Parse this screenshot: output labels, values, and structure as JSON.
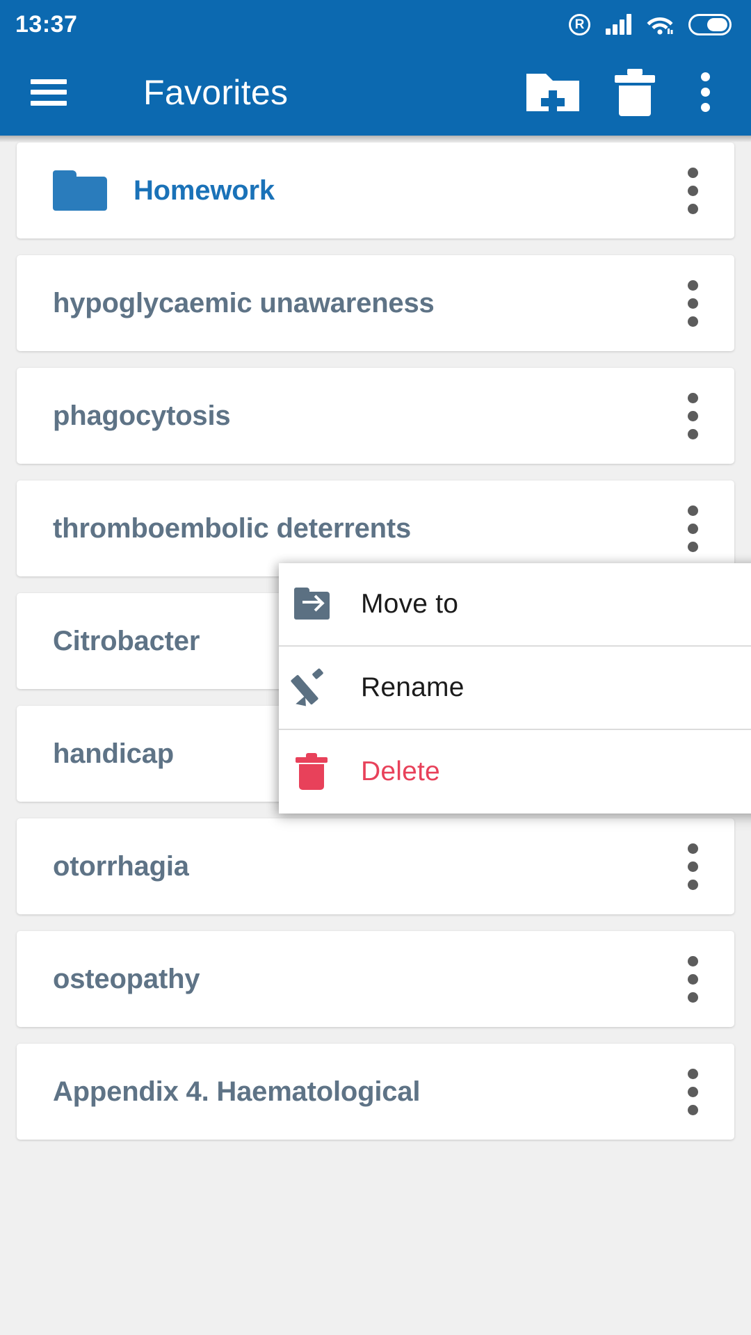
{
  "status_bar": {
    "time": "13:37",
    "roaming_glyph": "R",
    "icons": [
      "roaming-icon",
      "signal-icon",
      "wifi-icon",
      "battery-icon"
    ]
  },
  "toolbar": {
    "title": "Favorites",
    "menu_icon": "hamburger-icon",
    "new_folder_icon": "new-folder-icon",
    "delete_icon": "trash-icon",
    "overflow_icon": "overflow-menu-icon"
  },
  "colors": {
    "primary": "#0C69B0",
    "folder_text": "#1A72B8",
    "item_text": "#5E7386",
    "danger": "#E8415A",
    "background": "#F0F0F0",
    "card": "#FFFFFF"
  },
  "list": {
    "items": [
      {
        "label": "Homework",
        "type": "folder"
      },
      {
        "label": "hypoglycaemic unawareness",
        "type": "entry"
      },
      {
        "label": "phagocytosis",
        "type": "entry"
      },
      {
        "label": "thromboembolic deterrents",
        "type": "entry"
      },
      {
        "label": "Citrobacter",
        "type": "entry"
      },
      {
        "label": "handicap",
        "type": "entry"
      },
      {
        "label": "otorrhagia",
        "type": "entry"
      },
      {
        "label": "osteopathy",
        "type": "entry"
      },
      {
        "label": "Appendix 4. Haematological",
        "type": "entry"
      }
    ]
  },
  "context_menu": {
    "items": [
      {
        "label": "Move to",
        "icon": "move-to-folder-icon",
        "danger": false
      },
      {
        "label": "Rename",
        "icon": "pencil-icon",
        "danger": false
      },
      {
        "label": "Delete",
        "icon": "trash-icon",
        "danger": true
      }
    ]
  }
}
